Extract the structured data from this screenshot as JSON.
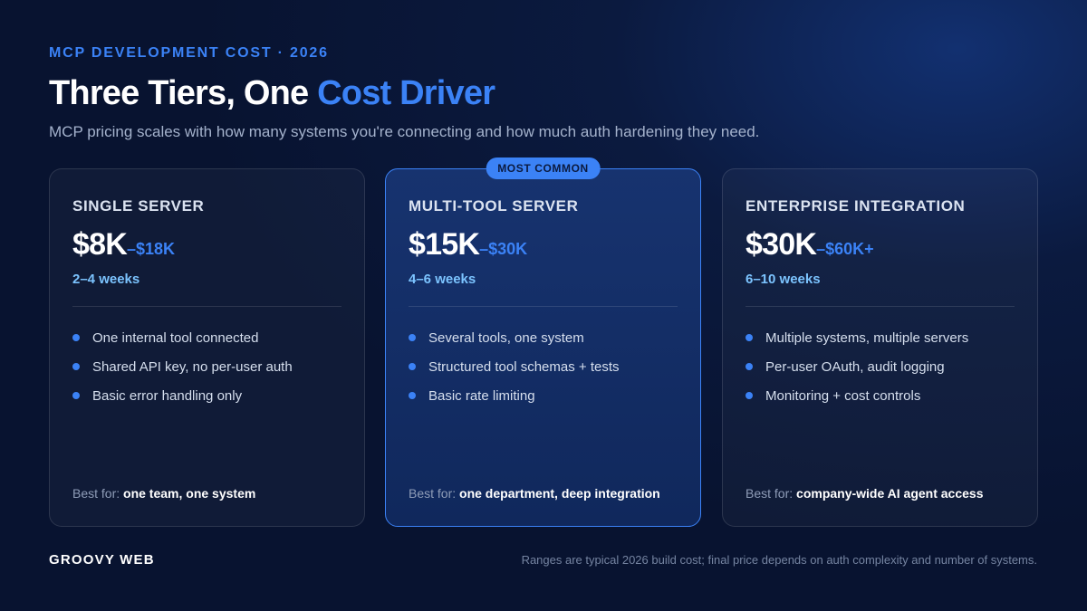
{
  "header": {
    "eyebrow": "MCP DEVELOPMENT COST · 2026",
    "title_main": "Three Tiers, One ",
    "title_accent": "Cost Driver",
    "subtitle": "MCP pricing scales with how many systems you're connecting and how much auth hardening they need."
  },
  "tiers": [
    {
      "name": "SINGLE SERVER",
      "price_low": "$8K",
      "price_high": "–$18K",
      "duration": "2–4 weeks",
      "features": [
        "One internal tool connected",
        "Shared API key, no per-user auth",
        "Basic error handling only"
      ],
      "best_for_label": "Best for: ",
      "best_for_value": "one team, one system"
    },
    {
      "badge": "MOST COMMON",
      "name": "MULTI-TOOL SERVER",
      "price_low": "$15K",
      "price_high": "–$30K",
      "duration": "4–6 weeks",
      "features": [
        "Several tools, one system",
        "Structured tool schemas + tests",
        "Basic rate limiting"
      ],
      "best_for_label": "Best for: ",
      "best_for_value": "one department, deep integration"
    },
    {
      "name": "ENTERPRISE INTEGRATION",
      "price_low": "$30K",
      "price_high": "–$60K+",
      "duration": "6–10 weeks",
      "features": [
        "Multiple systems, multiple servers",
        "Per-user OAuth, audit logging",
        "Monitoring + cost controls"
      ],
      "best_for_label": "Best for: ",
      "best_for_value": "company-wide AI agent access"
    }
  ],
  "footer": {
    "brand": "GROOVY WEB",
    "note": "Ranges are typical 2026 build cost; final price depends on auth complexity and number of systems."
  },
  "colors": {
    "accent": "#3b82f6",
    "duration": "#7cc4ff",
    "background": "#0b1a3f"
  }
}
